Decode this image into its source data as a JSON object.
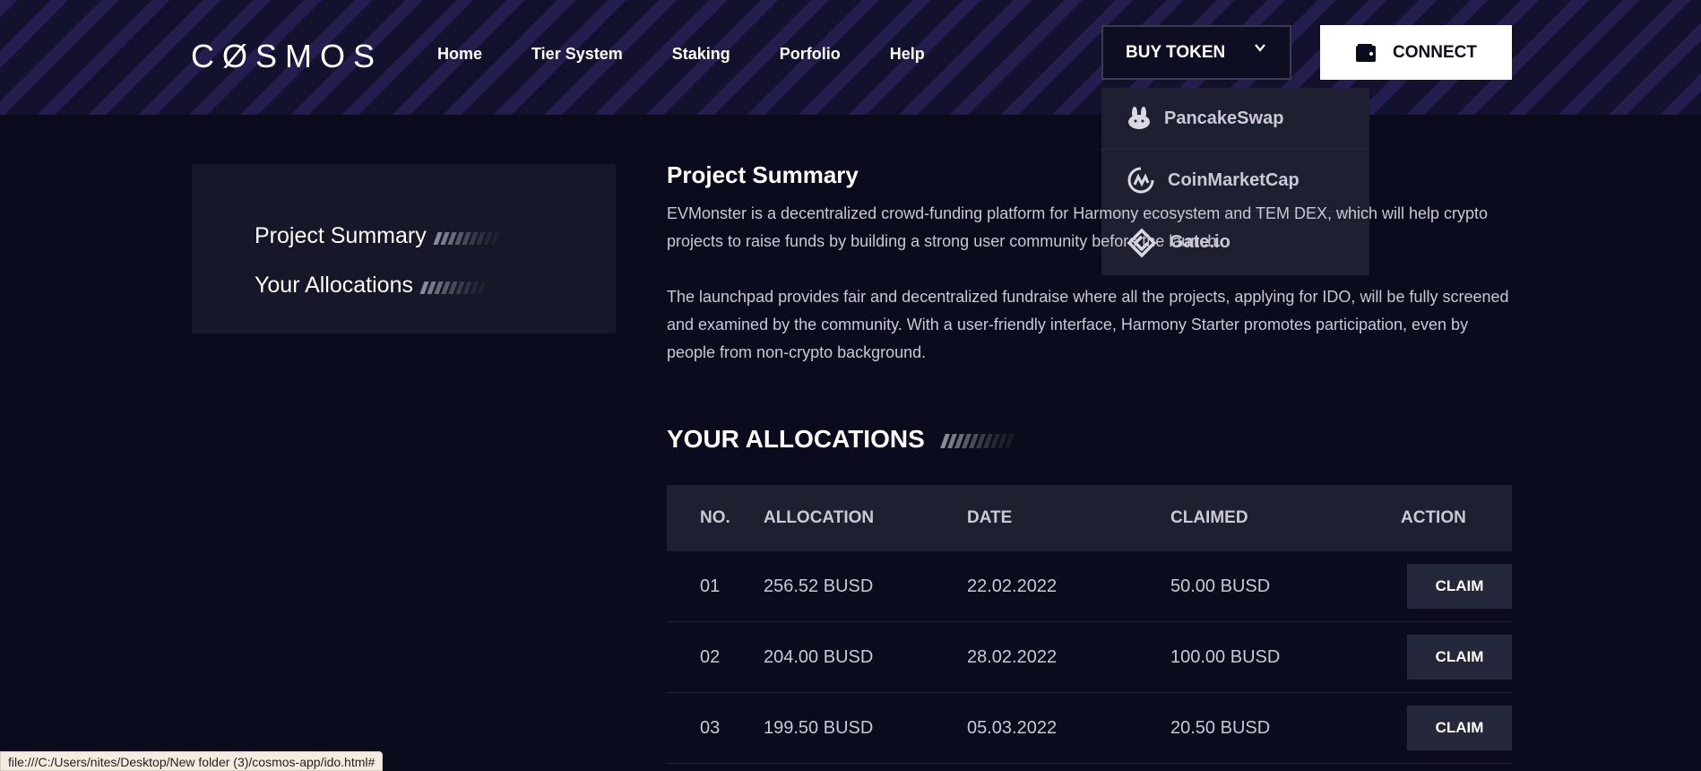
{
  "header": {
    "logo": "CØSMOS",
    "nav": [
      "Home",
      "Tier System",
      "Staking",
      "Porfolio",
      "Help"
    ],
    "buy_token_label": "BUY TOKEN",
    "connect_label": "CONNECT"
  },
  "dropdown": {
    "items": [
      {
        "label": "PancakeSwap",
        "icon": "pancakeswap-icon"
      },
      {
        "label": "CoinMarketCap",
        "icon": "coinmarketcap-icon"
      },
      {
        "label": "Gate.io",
        "icon": "gateio-icon"
      }
    ]
  },
  "sidebar": {
    "items": [
      "Project Summary",
      "Your Allocations"
    ]
  },
  "summary": {
    "title": "Project Summary",
    "para1": "EVMonster is a decentralized crowd-funding platform for Harmony ecosystem and TEM DEX, which will help crypto projects to raise funds by building a strong user community before the launch.",
    "para2": "The launchpad provides fair and decentralized fundraise where all the projects, applying for IDO, will be fully screened and examined by the community. With a user-friendly interface, Harmony Starter promotes participation, even by people from non-crypto background."
  },
  "allocations": {
    "heading": "YOUR ALLOCATIONS",
    "columns": [
      "NO.",
      "ALLOCATION",
      "DATE",
      "CLAIMED",
      "ACTION"
    ],
    "rows": [
      {
        "no": "01",
        "allocation": "256.52 BUSD",
        "date": "22.02.2022",
        "claimed": "50.00 BUSD",
        "action": "CLAIM"
      },
      {
        "no": "02",
        "allocation": "204.00 BUSD",
        "date": "28.02.2022",
        "claimed": "100.00 BUSD",
        "action": "CLAIM"
      },
      {
        "no": "03",
        "allocation": "199.50 BUSD",
        "date": "05.03.2022",
        "claimed": "20.50 BUSD",
        "action": "CLAIM"
      }
    ]
  },
  "status_bar": "file:///C:/Users/nites/Desktop/New folder (3)/cosmos-app/ido.html#",
  "colors": {
    "background": "#0a0b1c",
    "panel": "#161729",
    "table_header": "#1e1f31",
    "accent_white": "#ffffff"
  }
}
